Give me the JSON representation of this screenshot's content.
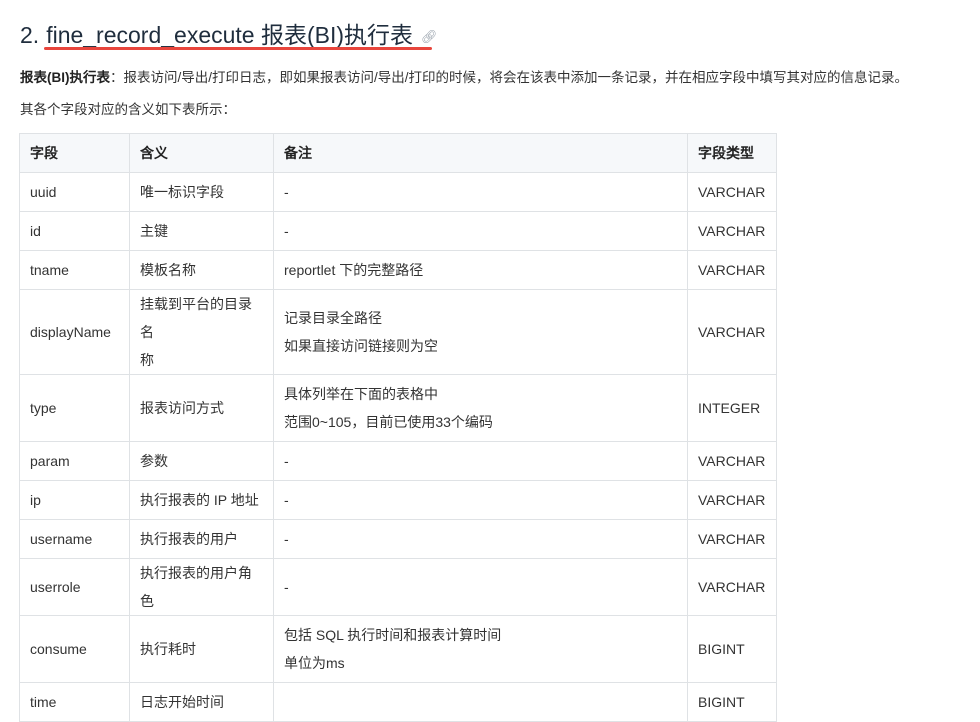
{
  "heading": {
    "number": "2.",
    "title": "fine_record_execute 报表(BI)执行表",
    "link_icon": "link-icon"
  },
  "intro": {
    "bold": "报表(BI)执行表",
    "text": "：报表访问/导出/打印日志，即如果报表访问/导出/打印的时候，将会在该表中添加一条记录，并在相应字段中填写其对应的信息记录。"
  },
  "intro2": "其各个字段对应的含义如下表所示：",
  "table": {
    "headers": [
      "字段",
      "含义",
      "备注",
      "字段类型"
    ],
    "rows": [
      {
        "field": "uuid",
        "meaning": [
          "唯一标识字段"
        ],
        "remark": [
          "-"
        ],
        "type": "VARCHAR",
        "tall": false
      },
      {
        "field": "id",
        "meaning": [
          "主键"
        ],
        "remark": [
          "-"
        ],
        "type": "VARCHAR",
        "tall": false
      },
      {
        "field": "tname",
        "meaning": [
          "模板名称"
        ],
        "remark": [
          "reportlet 下的完整路径"
        ],
        "type": "VARCHAR",
        "tall": false
      },
      {
        "field": "displayName",
        "meaning": [
          "挂载到平台的目录名",
          "称"
        ],
        "remark": [
          "记录目录全路径",
          "如果直接访问链接则为空"
        ],
        "type": "VARCHAR",
        "tall": true
      },
      {
        "field": "type",
        "meaning": [
          "报表访问方式"
        ],
        "remark": [
          "具体列举在下面的表格中",
          "范围0~105，目前已使用33个编码"
        ],
        "type": "INTEGER",
        "tall": true
      },
      {
        "field": "param",
        "meaning": [
          "参数"
        ],
        "remark": [
          "-"
        ],
        "type": "VARCHAR",
        "tall": false
      },
      {
        "field": "ip",
        "meaning": [
          "执行报表的 IP 地址"
        ],
        "remark": [
          "-"
        ],
        "type": "VARCHAR",
        "tall": false
      },
      {
        "field": "username",
        "meaning": [
          "执行报表的用户"
        ],
        "remark": [
          "-"
        ],
        "type": "VARCHAR",
        "tall": false
      },
      {
        "field": "userrole",
        "meaning": [
          "执行报表的用户角色"
        ],
        "remark": [
          "-"
        ],
        "type": "VARCHAR",
        "tall": false
      },
      {
        "field": "consume",
        "meaning": [
          "执行耗时"
        ],
        "remark": [
          "包括 SQL 执行时间和报表计算时间",
          "单位为ms"
        ],
        "type": "BIGINT",
        "tall": true
      },
      {
        "field": "time",
        "meaning": [
          "日志开始时间"
        ],
        "remark": [
          ""
        ],
        "type": "BIGINT",
        "tall": false
      }
    ]
  }
}
